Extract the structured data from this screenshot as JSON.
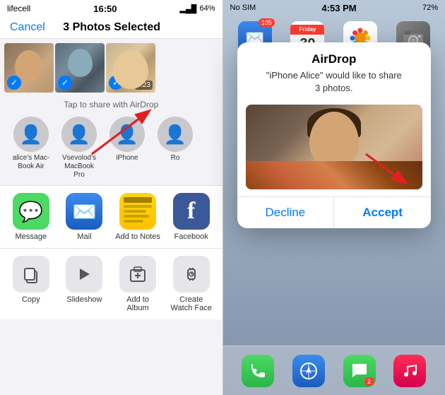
{
  "left": {
    "statusBar": {
      "carrier": "lifecell",
      "time": "16:50",
      "batteryPct": "64%"
    },
    "header": {
      "cancelLabel": "Cancel",
      "title": "3 Photos Selected"
    },
    "airdropLabel": "Tap to share with AirDrop",
    "contacts": [
      {
        "name": "alice's Mac-\nBook Air"
      },
      {
        "name": "Vsevolod's\nMacBook Pro"
      },
      {
        "name": "iPhone"
      },
      {
        "name": "Ro"
      }
    ],
    "apps": [
      {
        "label": "Message",
        "icon": "💬"
      },
      {
        "label": "Mail",
        "icon": "✉️"
      },
      {
        "label": "Add to Notes",
        "icon": "notes"
      },
      {
        "label": "Facebook",
        "icon": "f"
      }
    ],
    "actions": [
      {
        "label": "Copy",
        "icon": "copy"
      },
      {
        "label": "Slideshow",
        "icon": "play"
      },
      {
        "label": "Add to Album",
        "icon": "plus"
      },
      {
        "label": "Create\nWatch Face",
        "icon": "watch"
      }
    ]
  },
  "right": {
    "statusBar": {
      "carrier": "No SIM",
      "time": "4:53 PM",
      "batteryPct": "72%"
    },
    "dockApps": [
      {
        "label": "Mail",
        "badge": "105"
      },
      {
        "label": "Calendar",
        "day": "Friday",
        "date": "30"
      },
      {
        "label": "Photos"
      },
      {
        "label": "Camera"
      }
    ],
    "dialog": {
      "title": "AirDrop",
      "subtitle": "\"iPhone Alice\" would like to share\n3 photos.",
      "declineLabel": "Decline",
      "acceptLabel": "Accept"
    },
    "bottomDock": [
      {
        "label": "Phone"
      },
      {
        "label": "Safari"
      },
      {
        "label": "Messages"
      },
      {
        "label": "Music"
      }
    ]
  }
}
